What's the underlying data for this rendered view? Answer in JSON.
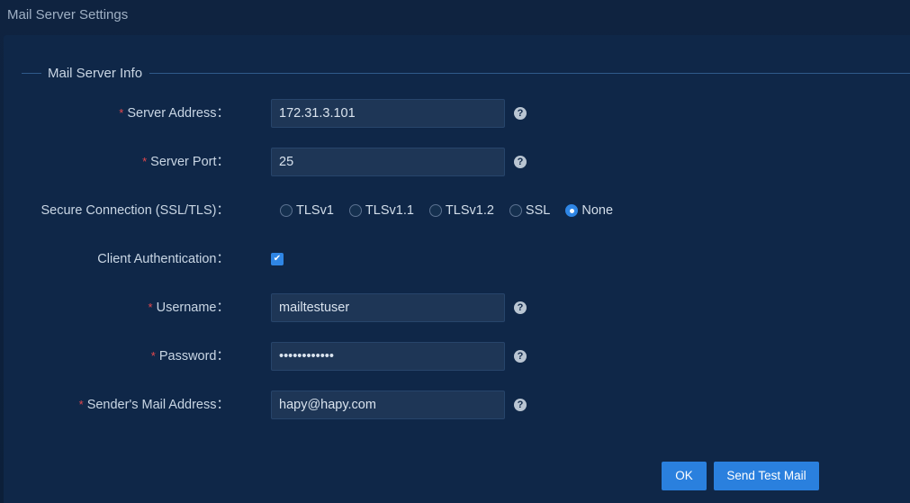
{
  "window": {
    "title": "Mail Server Settings"
  },
  "section": {
    "legend": "Mail Server Info"
  },
  "fields": {
    "server_address": {
      "label": "Server Address：",
      "value": "172.31.3.101",
      "required_mark": "*"
    },
    "server_port": {
      "label": "Server Port：",
      "value": "25",
      "required_mark": "*"
    },
    "secure_connection": {
      "label": "Secure Connection (SSL/TLS)：",
      "options": [
        "TLSv1",
        "TLSv1.1",
        "TLSv1.2",
        "SSL",
        "None"
      ],
      "selected": "None"
    },
    "client_auth": {
      "label": "Client Authentication：",
      "checked": true
    },
    "username": {
      "label": "Username：",
      "value": "mailtestuser",
      "required_mark": "*"
    },
    "password": {
      "label": "Password：",
      "value": "••••••••••••",
      "required_mark": "*"
    },
    "sender": {
      "label": "Sender's Mail Address：",
      "value": "hapy@hapy.com",
      "required_mark": "*"
    }
  },
  "help_icon": "?",
  "checkbox_mark": "✔",
  "buttons": {
    "ok": "OK",
    "send_test": "Send Test Mail"
  },
  "colors": {
    "accent": "#2a80de",
    "required": "#e5484d",
    "panel": "#0f2748"
  }
}
